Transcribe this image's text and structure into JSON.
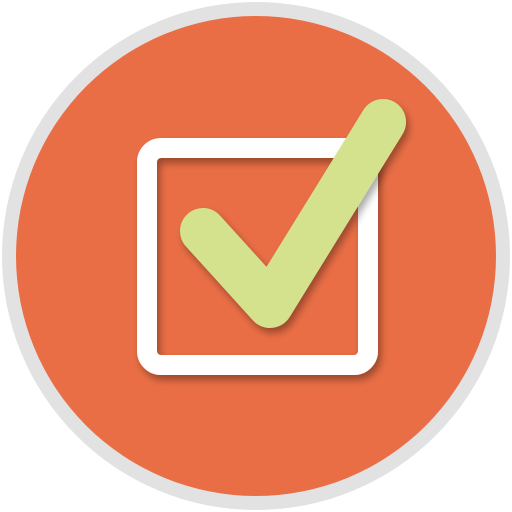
{
  "icon": {
    "name": "checkbox-checked-icon",
    "colors": {
      "outer_ring": "#e2e2e2",
      "disc": "#ea6e45",
      "box_stroke": "#ffffff",
      "check": "#d4e28e",
      "shadow": "#8a3a1f"
    }
  }
}
